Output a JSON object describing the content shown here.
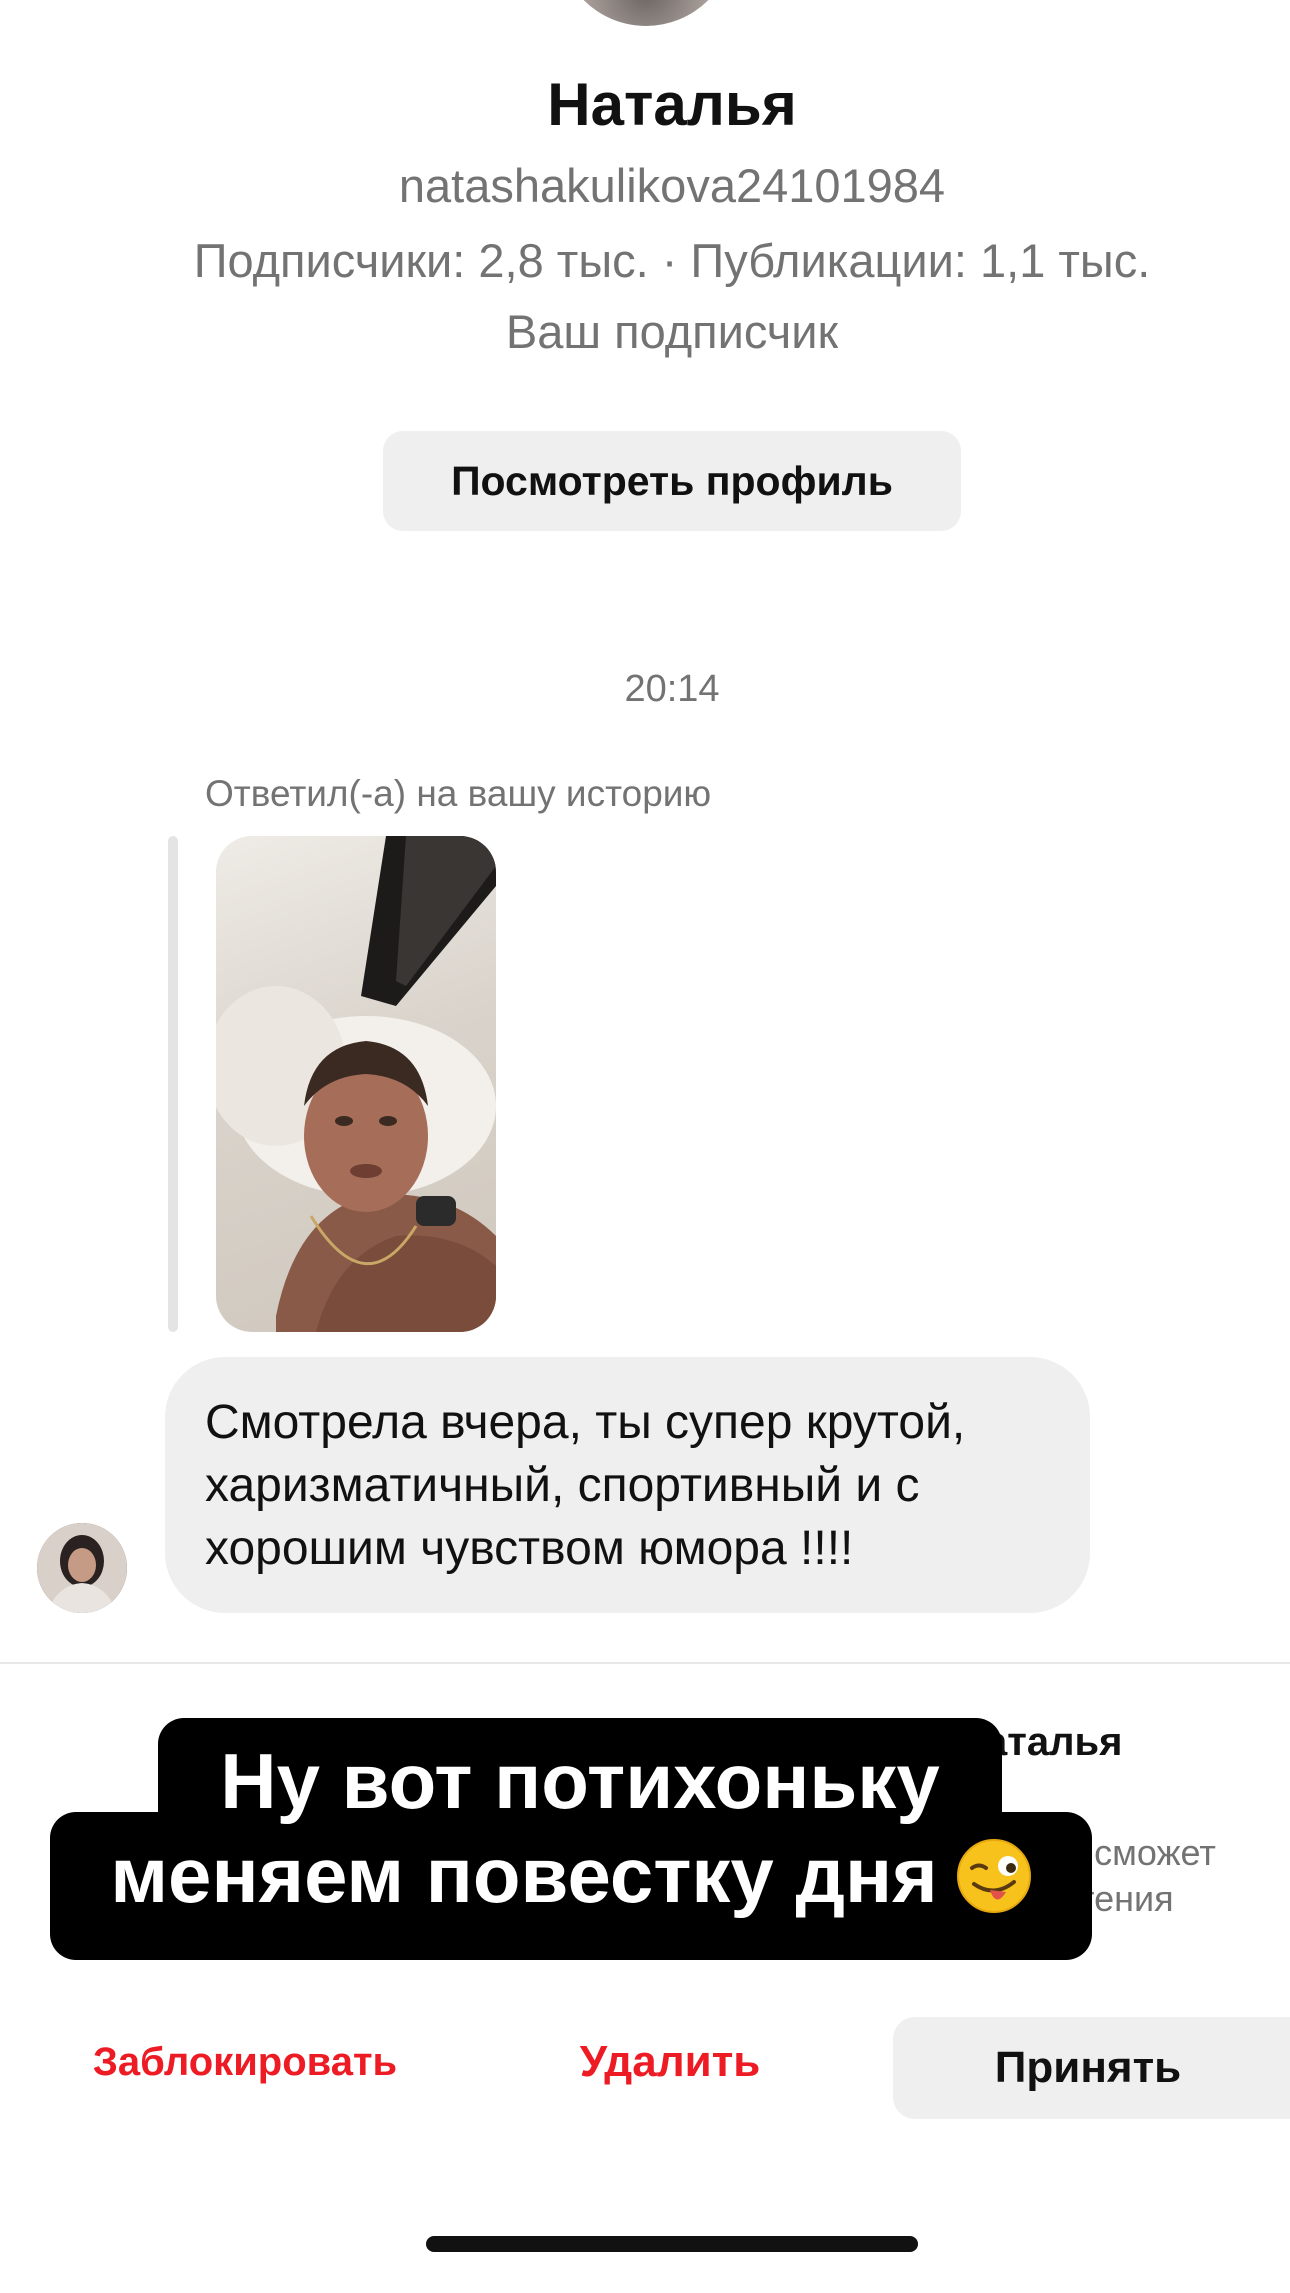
{
  "profile": {
    "name": "Наталья",
    "username": "natashakulikova24101984",
    "stats": "Подписчики: 2,8 тыс. · Публикации: 1,1 тыс.",
    "relation": "Ваш подписчик",
    "view_profile_label": "Посмотреть профиль"
  },
  "conversation": {
    "timestamp": "20:14",
    "reply_label": "Ответил(-а) на вашу историю",
    "message_lines": [
      "Смотрела вчера, ты супер крутой,",
      "харизматичный, спортивный и с",
      "хорошим чувством юмора !!!!"
    ]
  },
  "request": {
    "title_visible": "аталья",
    "desc_visible": "же сможет\nочтения"
  },
  "overlay_caption": {
    "line1": "Ну вот потихоньку",
    "line2": "меняем повестку дня",
    "emoji": "winking-face-with-tongue-icon"
  },
  "actions": {
    "block_label": "Заблокировать",
    "delete_label": "Удалить",
    "accept_label": "Принять"
  },
  "colors": {
    "danger": "#ed1b24",
    "button_bg": "#efefef",
    "secondary_text": "#737373",
    "caption_bg": "#000000"
  }
}
